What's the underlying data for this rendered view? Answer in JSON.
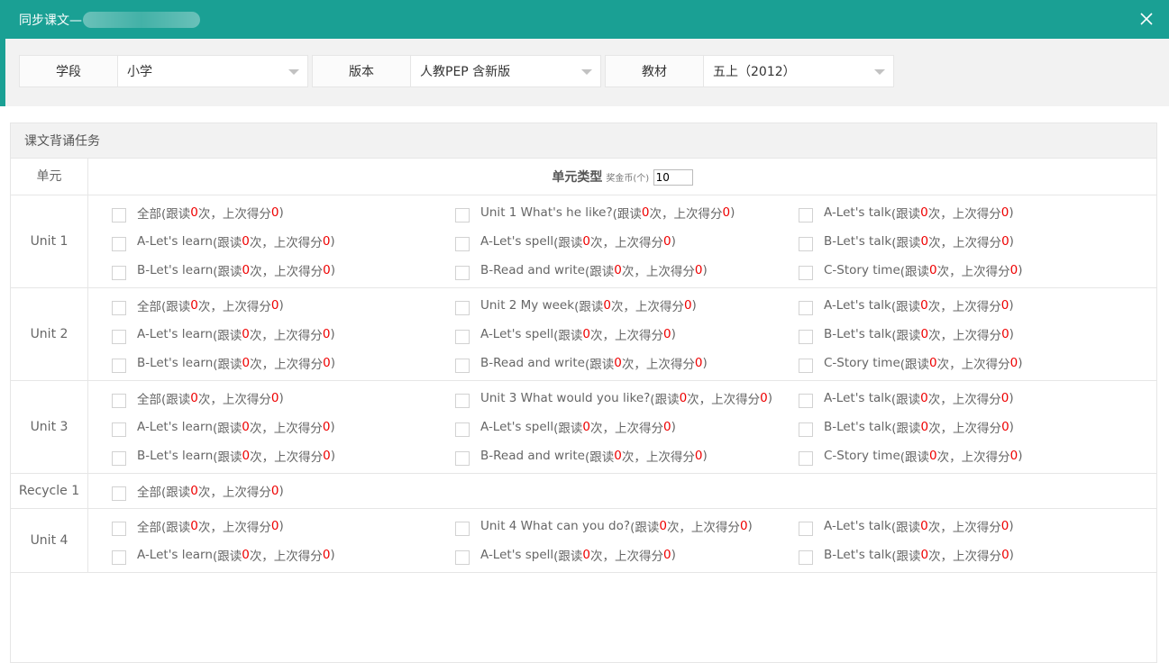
{
  "dialog": {
    "title": "同步课文—"
  },
  "filters": [
    {
      "label": "学段",
      "value": "小学"
    },
    {
      "label": "版本",
      "value": "人教PEP 含新版"
    },
    {
      "label": "教材",
      "value": "五上（2012）"
    }
  ],
  "panel": {
    "title": "课文背诵任务",
    "header": {
      "unit_col": "单元",
      "type_label": "单元类型",
      "coin_label": "奖金币(个)",
      "coin_value": "10"
    }
  },
  "units": [
    {
      "name": "Unit 1",
      "items": [
        {
          "label": "全部",
          "reads": "0",
          "score": "0"
        },
        {
          "label": "Unit 1 What's he like?",
          "reads": "0",
          "score": "0"
        },
        {
          "label": "A-Let's talk",
          "reads": "0",
          "score": "0"
        },
        {
          "label": "A-Let's learn",
          "reads": "0",
          "score": "0"
        },
        {
          "label": "A-Let's spell",
          "reads": "0",
          "score": "0"
        },
        {
          "label": "B-Let's talk",
          "reads": "0",
          "score": "0"
        },
        {
          "label": "B-Let's learn",
          "reads": "0",
          "score": "0"
        },
        {
          "label": "B-Read and write",
          "reads": "0",
          "score": "0"
        },
        {
          "label": "C-Story time",
          "reads": "0",
          "score": "0"
        }
      ]
    },
    {
      "name": "Unit 2",
      "items": [
        {
          "label": "全部",
          "reads": "0",
          "score": "0"
        },
        {
          "label": "Unit 2 My week",
          "reads": "0",
          "score": "0"
        },
        {
          "label": "A-Let's talk",
          "reads": "0",
          "score": "0"
        },
        {
          "label": "A-Let's learn",
          "reads": "0",
          "score": "0"
        },
        {
          "label": "A-Let's spell",
          "reads": "0",
          "score": "0"
        },
        {
          "label": "B-Let's talk",
          "reads": "0",
          "score": "0"
        },
        {
          "label": "B-Let's learn",
          "reads": "0",
          "score": "0"
        },
        {
          "label": "B-Read and write",
          "reads": "0",
          "score": "0"
        },
        {
          "label": "C-Story time",
          "reads": "0",
          "score": "0"
        }
      ]
    },
    {
      "name": "Unit 3",
      "items": [
        {
          "label": "全部",
          "reads": "0",
          "score": "0"
        },
        {
          "label": "Unit 3 What would you like?",
          "reads": "0",
          "score": "0"
        },
        {
          "label": "A-Let's talk",
          "reads": "0",
          "score": "0"
        },
        {
          "label": "A-Let's learn",
          "reads": "0",
          "score": "0"
        },
        {
          "label": "A-Let's spell",
          "reads": "0",
          "score": "0"
        },
        {
          "label": "B-Let's talk",
          "reads": "0",
          "score": "0"
        },
        {
          "label": "B-Let's learn",
          "reads": "0",
          "score": "0"
        },
        {
          "label": "B-Read and write",
          "reads": "0",
          "score": "0"
        },
        {
          "label": "C-Story time",
          "reads": "0",
          "score": "0"
        }
      ]
    },
    {
      "name": "Recycle 1",
      "items": [
        {
          "label": "全部",
          "reads": "0",
          "score": "0"
        }
      ]
    },
    {
      "name": "Unit 4",
      "items": [
        {
          "label": "全部",
          "reads": "0",
          "score": "0"
        },
        {
          "label": "Unit 4 What can you do?",
          "reads": "0",
          "score": "0"
        },
        {
          "label": "A-Let's talk",
          "reads": "0",
          "score": "0"
        },
        {
          "label": "A-Let's learn",
          "reads": "0",
          "score": "0"
        },
        {
          "label": "A-Let's spell",
          "reads": "0",
          "score": "0"
        },
        {
          "label": "B-Let's talk",
          "reads": "0",
          "score": "0"
        }
      ]
    }
  ],
  "item_text": {
    "open": "(跟读",
    "times": "次，上次得分",
    "close": ")"
  }
}
